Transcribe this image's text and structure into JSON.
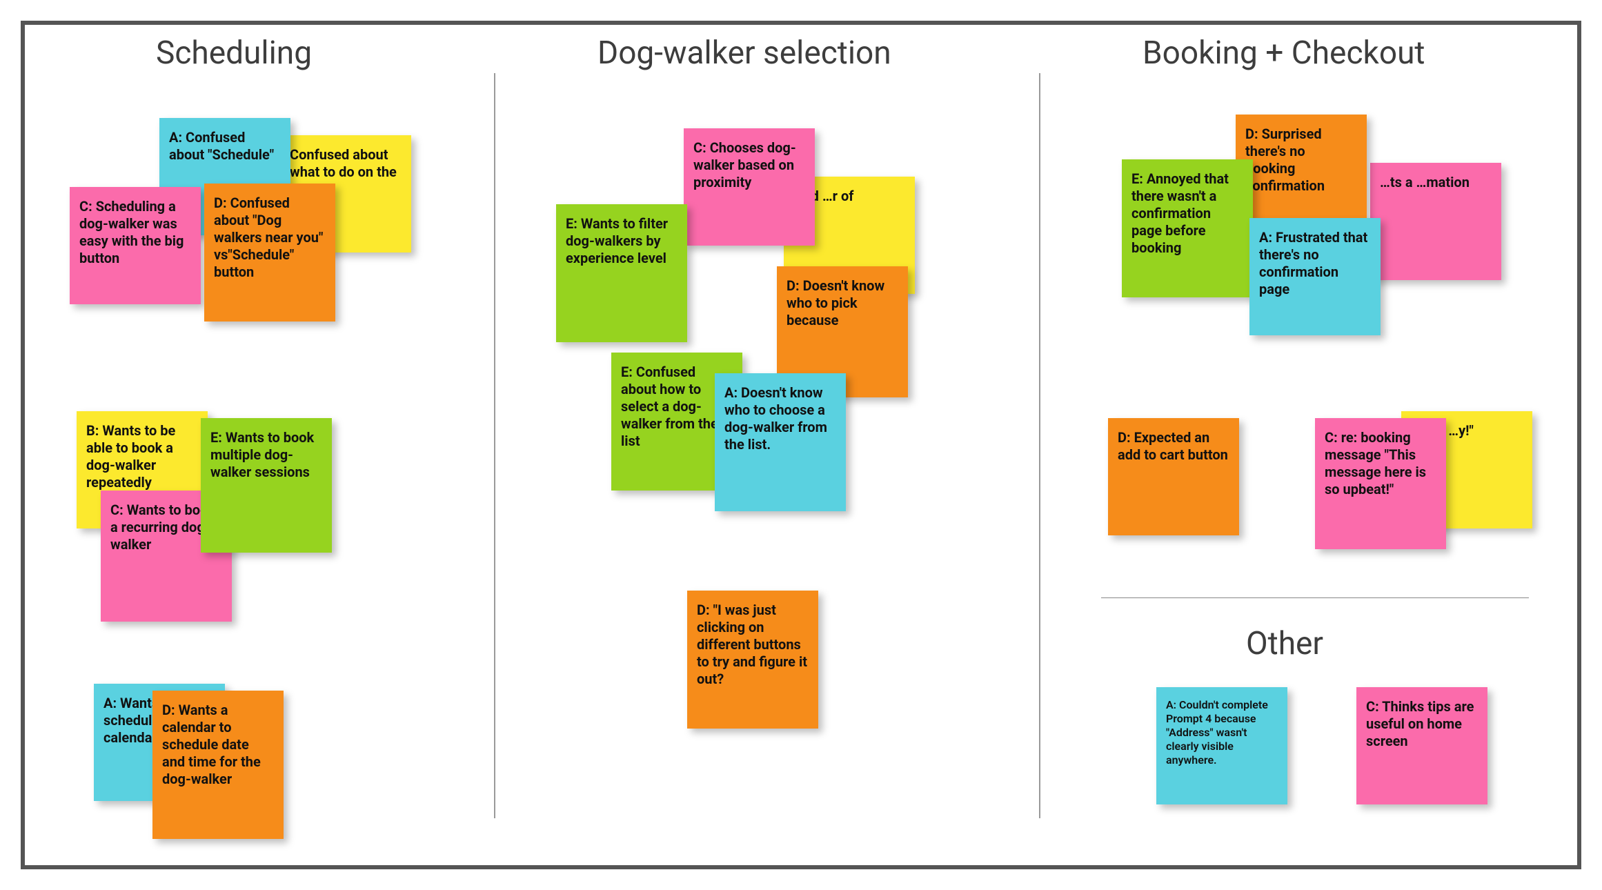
{
  "sections": {
    "scheduling": "Scheduling",
    "selection": "Dog-walker selection",
    "booking": "Booking + Checkout",
    "other": "Other"
  },
  "notes": {
    "sch_a_confused": "A: Confused about \"Schedule\"",
    "sch_b_confused_todo": "Confused about what to do on the screen",
    "sch_c_easy": "C: Scheduling a dog-walker was easy with the big button",
    "sch_d_confused_buttons": "D: Confused about \"Dog walkers near you\" vs\"Schedule\" button",
    "sch_b_book_repeat": "B: Wants to be able to book a dog-walker repeatedly",
    "sch_e_multi": "E: Wants to book multiple dog-walker sessions",
    "sch_c_recurring": "C: Wants to book a recurring dog walker",
    "sch_a_calendar": "A: Wants to schedule using a calendar",
    "sch_d_calendar": "D: Wants a calendar to schedule date and time for the dog-walker",
    "sel_c_proximity": "C: Chooses dog-walker based on proximity",
    "sel_yellow_partial": "…ed …r of",
    "sel_e_filter": "E: Wants to filter dog-walkers by experience level",
    "sel_d_dont_know": "D: Doesn't know who to pick because",
    "sel_e_confused_list": "E: Confused about how to select a dog-walker from the list",
    "sel_a_dont_know": "A: Doesn't know who to choose a dog-walker from the list.",
    "sel_d_clicking": "D: \"I was just clicking on different buttons to try and figure it out?",
    "bk_d_surprised": "D: Surprised there's no booking confirmation",
    "bk_e_annoyed": "E: Annoyed that there wasn't a confirmation page before booking",
    "bk_pink_confirm": "…ts a …mation",
    "bk_a_frustrated": "A: Frustrated that there's no confirmation page",
    "bk_d_add_cart": "D: Expected an add to cart button",
    "bk_yellow_prompt3": "…pt 3 …y!\"",
    "bk_c_upbeat": "C: re: booking message \"This message here is so upbeat!\"",
    "other_a_prompt4": "A: Couldn't complete Prompt 4 because \"Address\" wasn't clearly visible anywhere.",
    "other_c_tips": "C: Thinks tips are useful on home screen"
  }
}
